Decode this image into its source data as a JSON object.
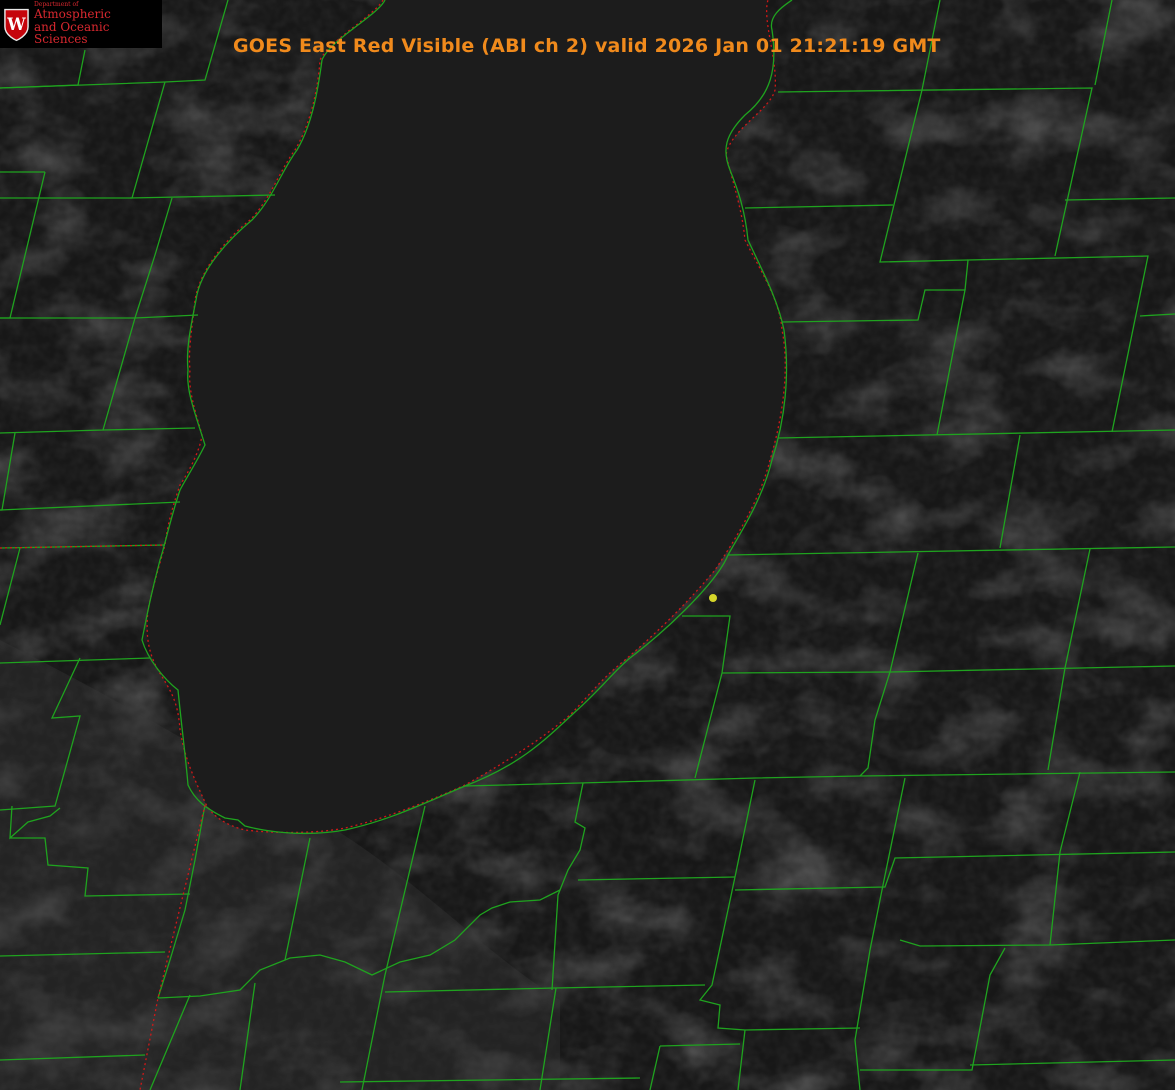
{
  "title": "GOES East Red Visible (ABI ch 2) valid 2026 Jan 01 21:21:19 GMT",
  "logo": {
    "department": "Department of",
    "name_line1": "Atmospheric",
    "name_line2": "and Oceanic Sciences",
    "seal_letter": "W"
  },
  "colors": {
    "background": "#151515",
    "lake": "#1b1b1b",
    "county_lines": "#1fa31f",
    "coastline_dotted": "#d01818",
    "title_text": "#f08a1c",
    "marker": "#d6d62a",
    "logo_red": "#c5050c"
  },
  "icons": {
    "logo": "university-seal-icon",
    "marker": "location-dot-icon"
  }
}
